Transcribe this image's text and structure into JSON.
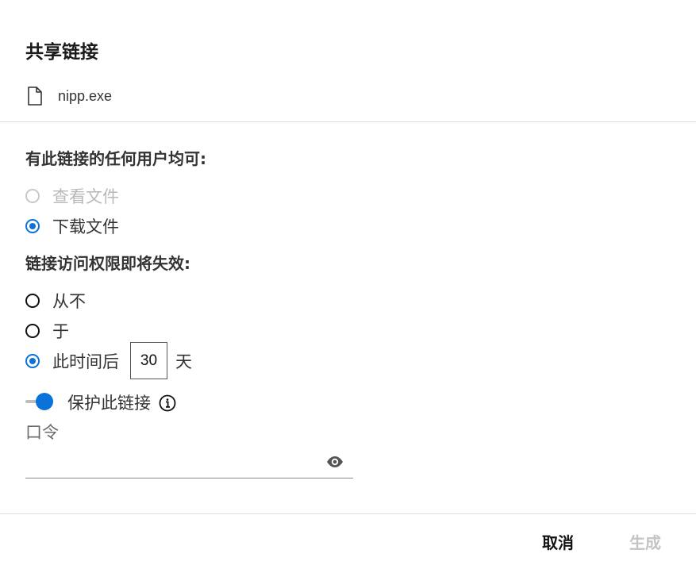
{
  "dialog": {
    "title": "共享链接",
    "file_name": "nipp.exe",
    "access_heading": "有此链接的任何用户均可:",
    "access_options": [
      {
        "label": "查看文件",
        "selected": false,
        "disabled": true
      },
      {
        "label": "下载文件",
        "selected": true,
        "disabled": false
      }
    ],
    "expiry_heading": "链接访问权限即将失效:",
    "expiry_options": [
      {
        "label": "从不",
        "selected": false
      },
      {
        "label": "于",
        "selected": false
      },
      {
        "label": "此时间后",
        "selected": true
      }
    ],
    "days_value": "30",
    "days_unit": "天",
    "protect": {
      "label": "保护此链接",
      "enabled": true
    },
    "password": {
      "label": "口令",
      "value": ""
    },
    "buttons": {
      "cancel": "取消",
      "generate": "生成"
    }
  },
  "colors": {
    "accent": "#0a72d9",
    "disabled": "#c4c4c4"
  },
  "icons": [
    "file-icon",
    "info-icon",
    "eye-icon"
  ]
}
